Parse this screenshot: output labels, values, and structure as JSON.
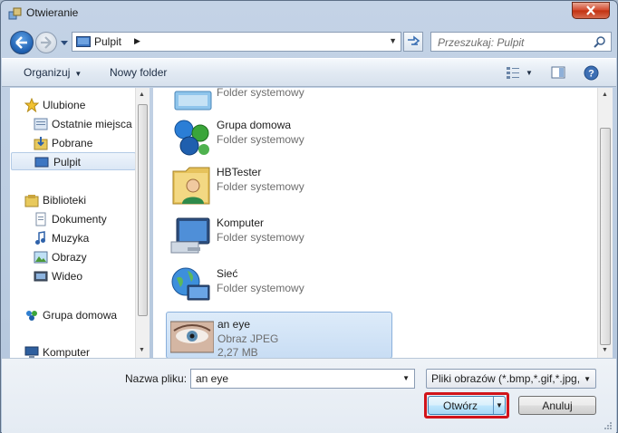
{
  "window": {
    "title": "Otwieranie"
  },
  "address": {
    "location": "Pulpit"
  },
  "search": {
    "placeholder": "Przeszukaj: Pulpit"
  },
  "toolbar": {
    "organize_label": "Organizuj",
    "new_folder_label": "Nowy folder"
  },
  "sidebar": {
    "items": [
      {
        "label": "Ulubione",
        "icon": "star-icon",
        "group": true
      },
      {
        "label": "Ostatnie miejsca",
        "icon": "recent-places-icon"
      },
      {
        "label": "Pobrane",
        "icon": "downloads-icon"
      },
      {
        "label": "Pulpit",
        "icon": "desktop-icon",
        "selected": true
      },
      {
        "label": "Biblioteki",
        "icon": "libraries-icon",
        "group": true
      },
      {
        "label": "Dokumenty",
        "icon": "documents-icon"
      },
      {
        "label": "Muzyka",
        "icon": "music-icon"
      },
      {
        "label": "Obrazy",
        "icon": "pictures-icon"
      },
      {
        "label": "Wideo",
        "icon": "video-icon"
      },
      {
        "label": "Grupa domowa",
        "icon": "homegroup-icon",
        "group": true
      },
      {
        "label": "Komputer",
        "icon": "computer-icon",
        "group": true
      }
    ]
  },
  "files": [
    {
      "name": "",
      "type": "Folder systemowy",
      "icon": "system-folder-icon"
    },
    {
      "name": "Grupa domowa",
      "type": "Folder systemowy",
      "icon": "homegroup-icon"
    },
    {
      "name": "HBTester",
      "type": "Folder systemowy",
      "icon": "user-folder-icon"
    },
    {
      "name": "Komputer",
      "type": "Folder systemowy",
      "icon": "computer-icon"
    },
    {
      "name": "Sieć",
      "type": "Folder systemowy",
      "icon": "network-icon"
    },
    {
      "name": "an eye",
      "type": "Obraz JPEG",
      "size": "2,27 MB",
      "icon": "image-thumbnail",
      "selected": true
    }
  ],
  "bottom": {
    "filename_label": "Nazwa pliku:",
    "filename_value": "an eye",
    "filter_value": "Pliki obrazów (*.bmp,*.gif,*.jpg,",
    "open_label": "Otwórz",
    "cancel_label": "Anuluj"
  },
  "colors": {
    "highlight": "#d1141a",
    "selection": "#c8ddf4",
    "titlebar": "#c4d3e6"
  }
}
